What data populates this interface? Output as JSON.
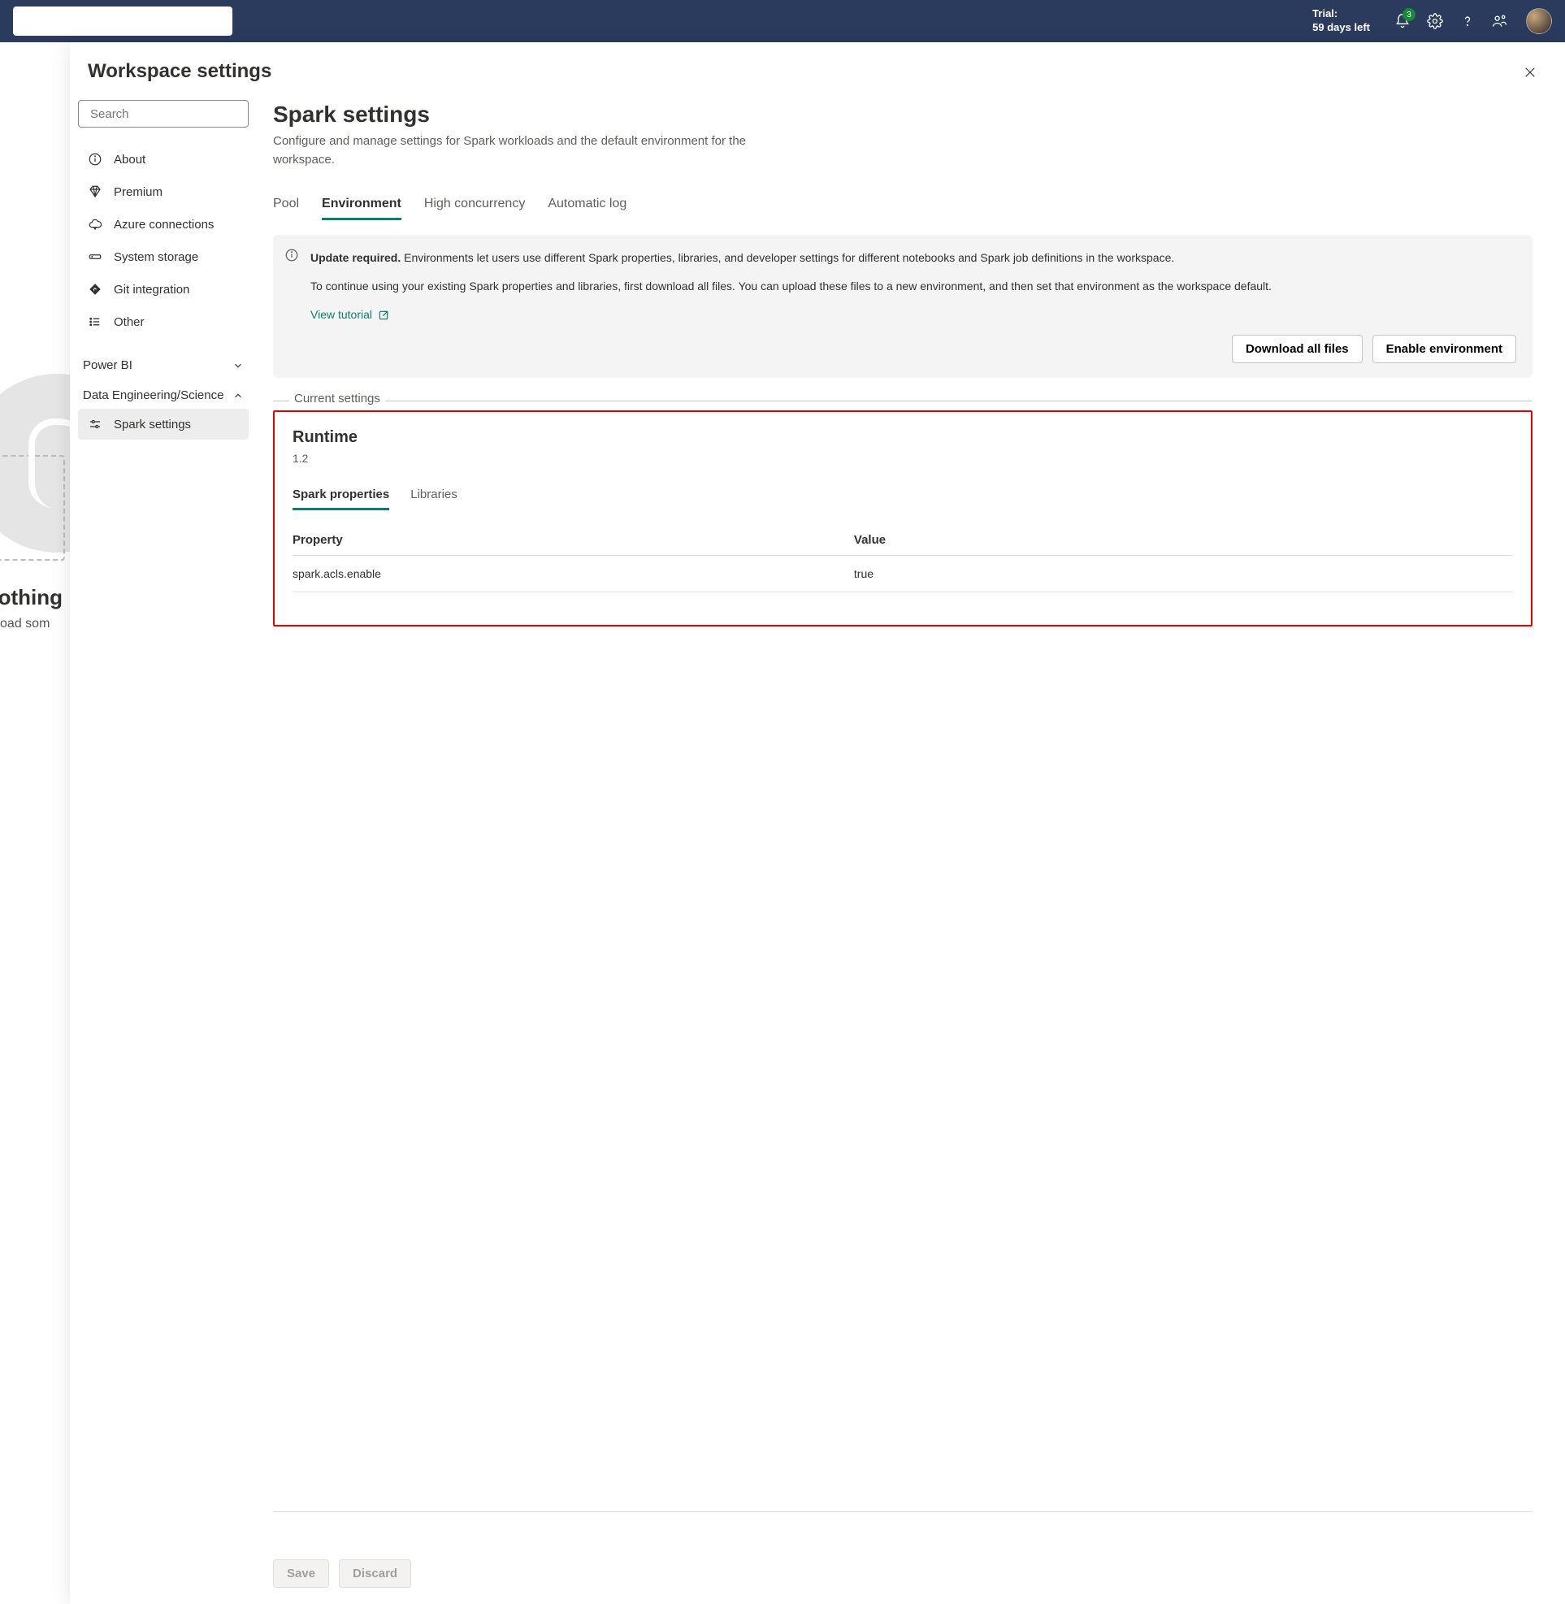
{
  "topbar": {
    "trial_line1": "Trial:",
    "trial_line2": "59 days left",
    "notif_count": "3"
  },
  "bg": {
    "heading_fragment": "s nothing",
    "sub_fragment": "or upload som"
  },
  "panel": {
    "title": "Workspace settings",
    "search_placeholder": "Search"
  },
  "sidebar": {
    "items": [
      {
        "icon": "info",
        "label": "About"
      },
      {
        "icon": "diamond",
        "label": "Premium"
      },
      {
        "icon": "cloud",
        "label": "Azure connections"
      },
      {
        "icon": "storage",
        "label": "System storage"
      },
      {
        "icon": "git",
        "label": "Git integration"
      },
      {
        "icon": "list",
        "label": "Other"
      }
    ],
    "group1": "Power BI",
    "group2": "Data Engineering/Science",
    "spark_label": "Spark settings"
  },
  "main": {
    "heading": "Spark settings",
    "subtitle": "Configure and manage settings for Spark workloads and the default environment for the workspace.",
    "tabs": [
      "Pool",
      "Environment",
      "High concurrency",
      "Automatic log"
    ],
    "active_tab": 1,
    "notice": {
      "strong": "Update required.",
      "text1": " Environments let users use different Spark properties, libraries, and developer settings for different notebooks and Spark job definitions in the workspace.",
      "text2": "To continue using your existing Spark properties and libraries, first download all files. You can upload these files to a new environment, and then set that environment as the workspace default.",
      "link": "View tutorial",
      "btn1": "Download all files",
      "btn2": "Enable environment"
    },
    "current_label": "Current settings",
    "runtime_heading": "Runtime",
    "runtime_version": "1.2",
    "inner_tabs": [
      "Spark properties",
      "Libraries"
    ],
    "table": {
      "col1": "Property",
      "col2": "Value",
      "rows": [
        {
          "prop": "spark.acls.enable",
          "val": "true"
        }
      ]
    },
    "save": "Save",
    "discard": "Discard"
  }
}
